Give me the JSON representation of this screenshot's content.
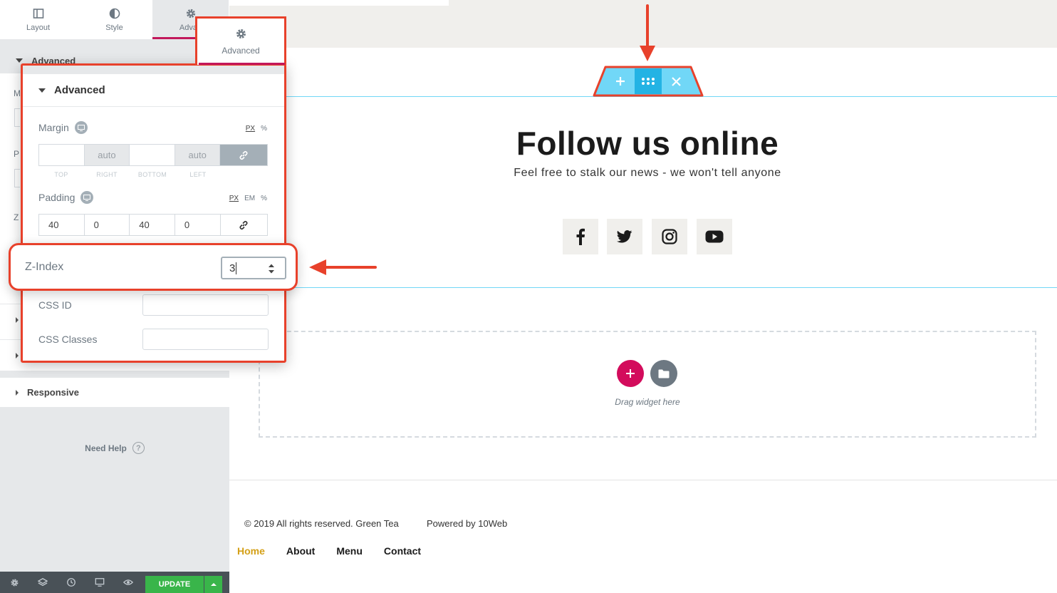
{
  "panel": {
    "tabs": [
      {
        "label": "Layout",
        "icon": "layout-icon"
      },
      {
        "label": "Style",
        "icon": "contrast-icon"
      },
      {
        "label": "Advan",
        "icon": "gear-icon"
      }
    ],
    "behind_section_title": "Advanced",
    "behind_letters": [
      "M",
      "P",
      "Z"
    ],
    "responsive_label": "Responsive",
    "need_help": "Need Help",
    "help_symbol": "?",
    "update_label": "UPDATE",
    "bottom_icons": [
      "settings-icon",
      "layers-icon",
      "history-icon",
      "responsive-icon",
      "eye-icon"
    ]
  },
  "callout": {
    "tab_label": "Advanced",
    "section_title": "Advanced",
    "margin": {
      "label": "Margin",
      "units": [
        "PX",
        "%"
      ],
      "selected_unit": "PX",
      "values": [
        "",
        "auto",
        "",
        "auto"
      ],
      "captions": [
        "TOP",
        "RIGHT",
        "BOTTOM",
        "LEFT"
      ]
    },
    "padding": {
      "label": "Padding",
      "units": [
        "PX",
        "EM",
        "%"
      ],
      "selected_unit": "PX",
      "values": [
        "40",
        "0",
        "40",
        "0"
      ]
    },
    "zindex": {
      "label": "Z-Index",
      "value": "3"
    },
    "css_id": {
      "label": "CSS ID",
      "value": ""
    },
    "css_classes": {
      "label": "CSS Classes",
      "value": ""
    }
  },
  "canvas": {
    "title": "Follow us online",
    "subtitle": "Feel free to stalk our news - we won't tell anyone",
    "handle_buttons": [
      "add-icon",
      "drag-icon",
      "close-icon"
    ],
    "social_icons": [
      "facebook-icon",
      "twitter-icon",
      "instagram-icon",
      "youtube-icon"
    ],
    "drop_zone_text": "Drag widget here",
    "footer": {
      "copyright": "© 2019 All rights reserved. Green Tea",
      "powered": "Powered by 10Web",
      "nav": [
        "Home",
        "About",
        "Menu",
        "Contact"
      ]
    }
  },
  "colors": {
    "accent": "#c2185b",
    "callout_border": "#e8412b",
    "handle_blue": "#71d7f7",
    "handle_blue_dark": "#23b3e4",
    "update_green": "#39b54a",
    "footer_active": "#d4a017"
  }
}
